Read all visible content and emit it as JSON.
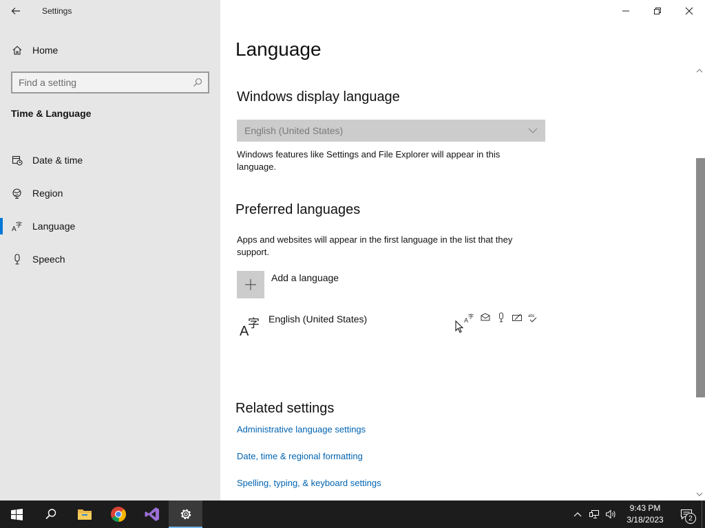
{
  "window": {
    "title": "Settings"
  },
  "sidebar": {
    "home_label": "Home",
    "search_placeholder": "Find a setting",
    "section_title": "Time & Language",
    "items": [
      {
        "label": "Date & time",
        "icon": "calendar-clock-icon"
      },
      {
        "label": "Region",
        "icon": "globe-icon"
      },
      {
        "label": "Language",
        "icon": "language-icon",
        "selected": true
      },
      {
        "label": "Speech",
        "icon": "microphone-icon"
      }
    ]
  },
  "main": {
    "page_title": "Language",
    "display_language": {
      "heading": "Windows display language",
      "selected_value": "English (United States)",
      "description": "Windows features like Settings and File Explorer will appear in this language."
    },
    "preferred_languages": {
      "heading": "Preferred languages",
      "description": "Apps and websites will appear in the first language in the list that they support.",
      "add_label": "Add a language",
      "languages": [
        {
          "name": "English (United States)",
          "features": [
            "display-language-icon",
            "text-to-speech-icon",
            "speech-recognition-icon",
            "handwriting-icon",
            "spell-check-icon"
          ]
        }
      ]
    },
    "related_settings": {
      "heading": "Related settings",
      "links": [
        "Administrative language settings",
        "Date, time & regional formatting",
        "Spelling, typing, & keyboard settings"
      ]
    }
  },
  "taskbar": {
    "apps": [
      "start-button",
      "search-button",
      "file-explorer",
      "chrome",
      "visual-studio",
      "settings"
    ],
    "time": "9:43 PM",
    "date": "3/18/2023",
    "notification_count": "2"
  },
  "colors": {
    "accent": "#0078d7",
    "link": "#0063b1",
    "sidebar_bg": "#e6e6e6",
    "taskbar_bg": "#1c1c1c"
  }
}
